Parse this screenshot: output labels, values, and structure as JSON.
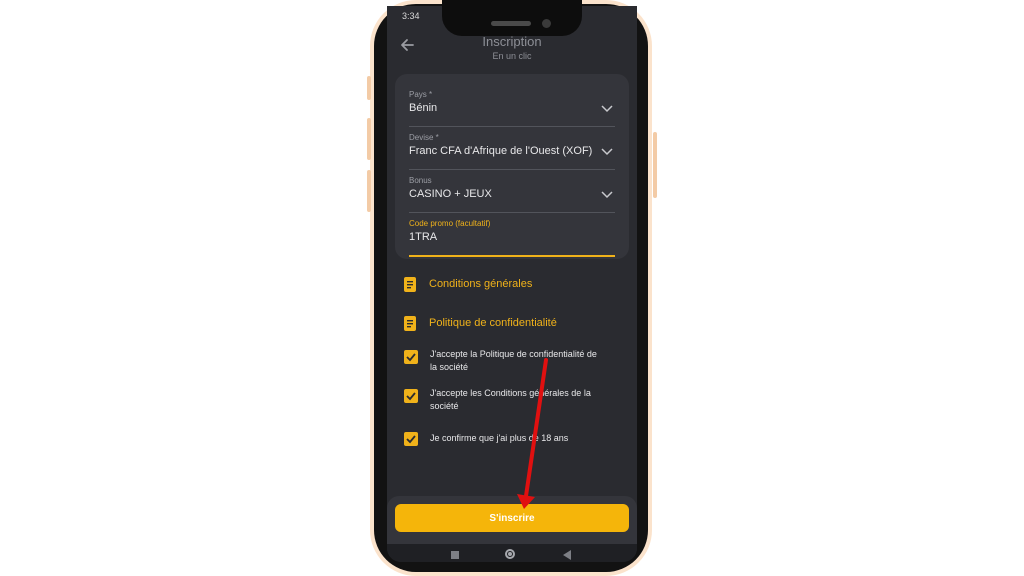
{
  "status": {
    "time": "3:34",
    "right": ""
  },
  "header": {
    "title": "Inscription",
    "subtitle": "En un clic"
  },
  "form": {
    "country": {
      "label": "Pays *",
      "value": "Bénin"
    },
    "currency": {
      "label": "Devise *",
      "value": "Franc CFA d'Afrique de l'Ouest (XOF)"
    },
    "bonus": {
      "label": "Bonus",
      "value": "CASINO + JEUX"
    },
    "promo": {
      "label": "Code promo (facultatif)",
      "value": "1TRA"
    }
  },
  "links": {
    "terms": "Conditions générales",
    "privacy": "Politique de confidentialité"
  },
  "checks": [
    {
      "label": "J'accepte la Politique de confidentialité de la société",
      "checked": true
    },
    {
      "label": "J'accepte les Conditions générales de la société",
      "checked": true
    },
    {
      "label": "Je confirme que j'ai plus de 18 ans",
      "checked": true
    }
  ],
  "submit_label": "S'inscrire",
  "colors": {
    "accent": "#f5b50a",
    "background": "#2a2b30",
    "card": "#34353b",
    "annotation_arrow": "#e01010"
  },
  "icons": {
    "back": "arrow-left-icon",
    "dropdown": "chevron-down-icon",
    "document": "document-icon",
    "checkbox": "checkmark-icon"
  }
}
